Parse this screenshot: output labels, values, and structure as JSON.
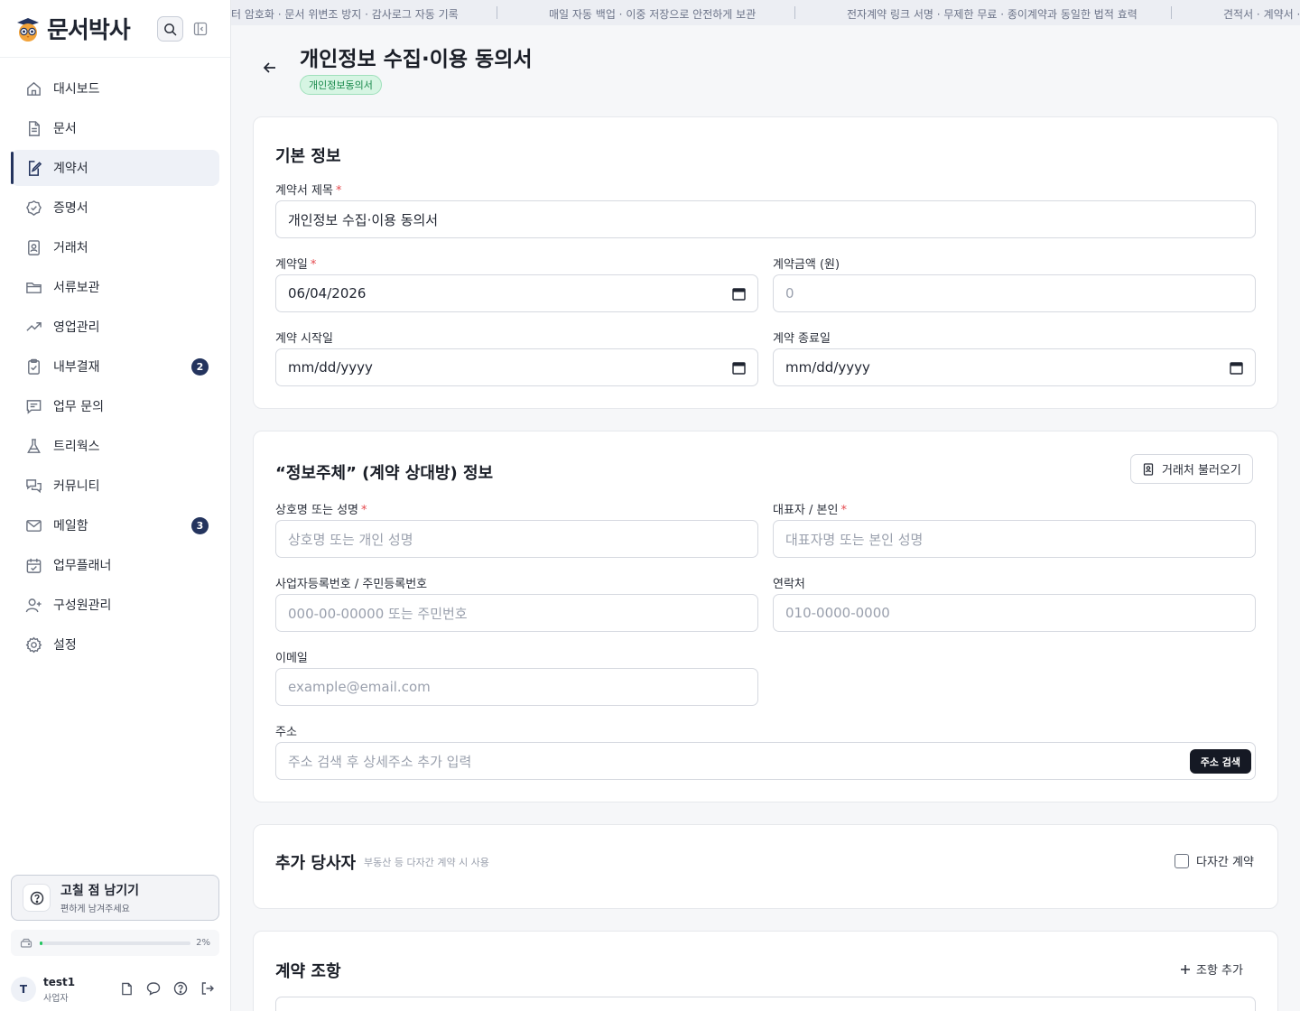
{
  "sidebar": {
    "brand": "문서박사",
    "nav": [
      {
        "label": "대시보드",
        "icon": "home-icon"
      },
      {
        "label": "문서",
        "icon": "document-icon"
      },
      {
        "label": "계약서",
        "icon": "contract-edit-icon",
        "active": true
      },
      {
        "label": "증명서",
        "icon": "badge-check-icon"
      },
      {
        "label": "거래처",
        "icon": "contact-card-icon"
      },
      {
        "label": "서류보관",
        "icon": "folder-icon"
      },
      {
        "label": "영업관리",
        "icon": "trending-up-icon"
      },
      {
        "label": "내부결재",
        "icon": "clipboard-check-icon",
        "badge": "2"
      },
      {
        "label": "업무 문의",
        "icon": "message-square-icon"
      },
      {
        "label": "트리웍스",
        "icon": "flask-icon"
      },
      {
        "label": "커뮤니티",
        "icon": "chat-bubbles-icon"
      },
      {
        "label": "메일함",
        "icon": "mail-icon",
        "badge": "3"
      },
      {
        "label": "업무플래너",
        "icon": "calendar-icon"
      },
      {
        "label": "구성원관리",
        "icon": "user-plus-icon"
      },
      {
        "label": "설정",
        "icon": "gear-icon"
      }
    ],
    "feedback": {
      "title": "고칠 점 남기기",
      "subtitle": "편하게 남겨주세요"
    },
    "storage": {
      "percent_label": "2%",
      "fill": 0.02
    },
    "user": {
      "initial": "T",
      "name": "test1",
      "role": "사업자"
    }
  },
  "marquee": [
    "터 암호화 · 문서 위변조 방지 · 감사로그 자동 기록",
    "매일 자동 백업 · 이중 저장으로 안전하게 보관",
    "전자계약 링크 서명 · 무제한 무료 · 종이계약과 동일한 법적 효력",
    "견적서 · 계약서 · 견"
  ],
  "page": {
    "title": "개인정보 수집·이용 동의서",
    "tag": "개인정보동의서"
  },
  "basic": {
    "title": "기본 정보",
    "contract_title_label": "계약서 제목",
    "contract_title_value": "개인정보 수집·이용 동의서",
    "contract_date_label": "계약일",
    "contract_date_value": "06/04/2026",
    "amount_label": "계약금액 (원)",
    "amount_placeholder": "0",
    "start_label": "계약 시작일",
    "start_placeholder": "mm/dd/yyyy",
    "end_label": "계약 종료일",
    "end_placeholder": "mm/dd/yyyy"
  },
  "party": {
    "title": "“정보주체” (계약 상대방) 정보",
    "load_button": "거래처 불러오기",
    "name_label": "상호명 또는 성명",
    "name_placeholder": "상호명 또는 개인 성명",
    "rep_label": "대표자 / 본인",
    "rep_placeholder": "대표자명 또는 본인 성명",
    "regno_label": "사업자등록번호 / 주민등록번호",
    "regno_placeholder": "000-00-00000 또는 주민번호",
    "phone_label": "연락처",
    "phone_placeholder": "010-0000-0000",
    "email_label": "이메일",
    "email_placeholder": "example@email.com",
    "address_label": "주소",
    "address_placeholder": "주소 검색 후 상세주소 추가 입력",
    "address_button": "주소 검색"
  },
  "extra": {
    "title": "추가 당사자",
    "hint": "부동산 등 다자간 계약 시 사용",
    "checkbox_label": "다자간 계약"
  },
  "clauses": {
    "title": "계약 조항",
    "add_button": "조항 추가"
  }
}
